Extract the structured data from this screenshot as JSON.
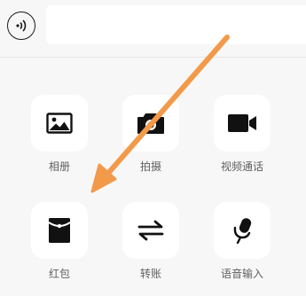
{
  "input": {
    "value": "",
    "placeholder": ""
  },
  "icons": {
    "voice_toggle": "voice-wave-icon",
    "album": "image-icon",
    "shoot": "camera-icon",
    "video_call": "video-camera-icon",
    "red_packet": "red-packet-icon",
    "transfer": "transfer-arrows-icon",
    "voice_input": "microphone-icon"
  },
  "tiles": [
    {
      "label": "相册"
    },
    {
      "label": "拍摄"
    },
    {
      "label": "视频通话"
    },
    {
      "label": "红包"
    },
    {
      "label": "转账"
    },
    {
      "label": "语音输入"
    }
  ],
  "colors": {
    "background": "#f7f7f7",
    "tile": "#ffffff",
    "icon": "#111111",
    "label": "#5f5f5f",
    "annotation_arrow": "#f29a4a"
  },
  "annotation": {
    "icon": "pointer-arrow-icon"
  }
}
